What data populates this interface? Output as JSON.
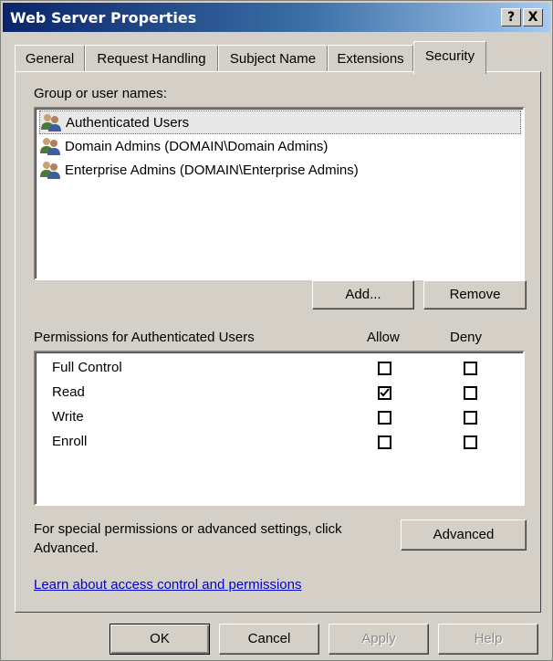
{
  "window": {
    "title": "Web Server Properties",
    "help_btn": "?",
    "close_btn": "X"
  },
  "tabs": [
    {
      "label": "General"
    },
    {
      "label": "Request Handling"
    },
    {
      "label": "Subject Name"
    },
    {
      "label": "Extensions"
    },
    {
      "label": "Security",
      "active": true
    }
  ],
  "group": {
    "label": "Group or user names:",
    "users": [
      {
        "name": "Authenticated Users",
        "selected": true
      },
      {
        "name": "Domain Admins (DOMAIN\\Domain Admins)"
      },
      {
        "name": "Enterprise Admins (DOMAIN\\Enterprise Admins)"
      }
    ],
    "icon": "users-group-icon"
  },
  "buttons": {
    "add": "Add...",
    "remove": "Remove",
    "advanced": "Advanced",
    "ok": "OK",
    "cancel": "Cancel",
    "apply": "Apply",
    "help": "Help"
  },
  "permissions": {
    "header": "Permissions for Authenticated Users",
    "allow": "Allow",
    "deny": "Deny",
    "rows": [
      {
        "name": "Full Control",
        "allow": false,
        "deny": false
      },
      {
        "name": "Read",
        "allow": true,
        "deny": false
      },
      {
        "name": "Write",
        "allow": false,
        "deny": false
      },
      {
        "name": "Enroll",
        "allow": false,
        "deny": false
      }
    ]
  },
  "advanced_text_line1": "For special permissions or advanced settings, click",
  "advanced_text_line2": "Advanced.",
  "link": "Learn about access control and permissions"
}
